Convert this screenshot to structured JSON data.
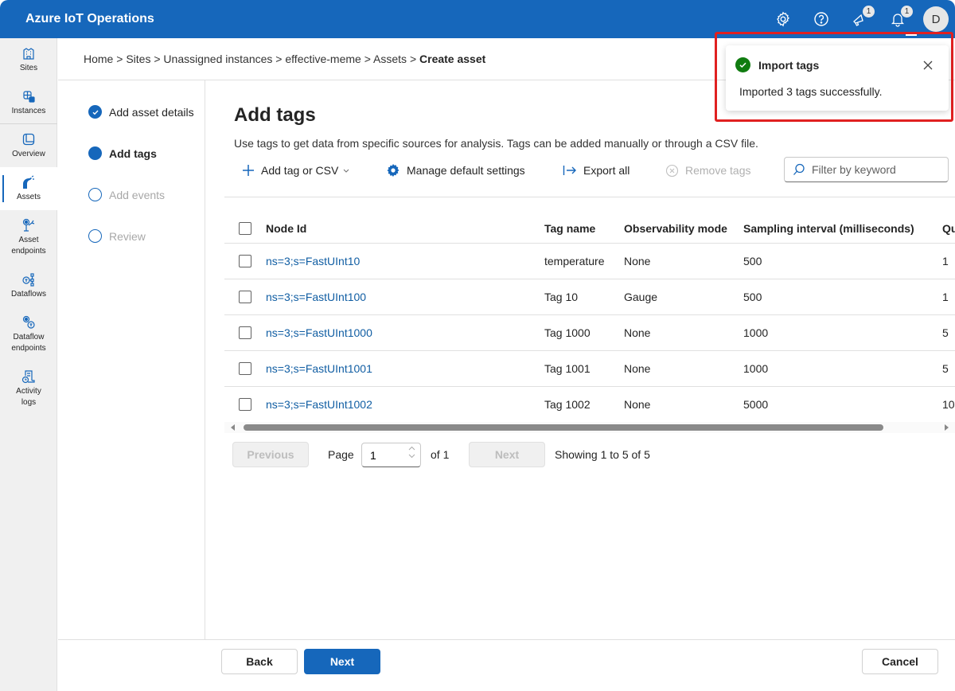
{
  "app": {
    "title": "Azure IoT Operations"
  },
  "topbar": {
    "settings_label": "Settings",
    "help_label": "Help",
    "whats_new_badge": "1",
    "notifications_badge": "1",
    "avatar_initial": "D"
  },
  "nav": {
    "items": [
      {
        "label": "Sites",
        "icon": "building-icon"
      },
      {
        "label": "Instances",
        "icon": "instances-icon"
      },
      {
        "label": "Overview",
        "icon": "overview-icon"
      },
      {
        "label": "Assets",
        "icon": "robot-arm-icon",
        "active": true
      },
      {
        "label_line1": "Asset",
        "label_line2": "endpoints",
        "icon": "asset-endpoint-icon"
      },
      {
        "label": "Dataflows",
        "icon": "dataflow-icon"
      },
      {
        "label_line1": "Dataflow",
        "label_line2": "endpoints",
        "icon": "dataflow-endpoint-icon"
      },
      {
        "label_line1": "Activity",
        "label_line2": "logs",
        "icon": "activity-log-icon"
      }
    ]
  },
  "breadcrumb": {
    "items": [
      "Home",
      "Sites",
      "Unassigned instances",
      "effective-meme",
      "Assets"
    ],
    "separator": ">",
    "current": "Create asset"
  },
  "steps": [
    {
      "label": "Add asset details",
      "state": "done"
    },
    {
      "label": "Add tags",
      "state": "current"
    },
    {
      "label": "Add events",
      "state": "todo"
    },
    {
      "label": "Review",
      "state": "todo"
    }
  ],
  "main": {
    "title": "Add tags",
    "description": "Use tags to get data from specific sources for analysis. Tags can be added manually or through a CSV file.",
    "toolbar": {
      "add_label": "Add tag or CSV",
      "manage_label": "Manage default settings",
      "export_label": "Export all",
      "remove_label": "Remove tags"
    },
    "search": {
      "placeholder": "Filter by keyword",
      "value": ""
    }
  },
  "table": {
    "columns": [
      "Node Id",
      "Tag name",
      "Observability mode",
      "Sampling interval (milliseconds)",
      "Qu"
    ],
    "rows": [
      {
        "node_id": "ns=3;s=FastUInt10",
        "tag_name": "temperature",
        "mode": "None",
        "sampling": "500",
        "queue": "1"
      },
      {
        "node_id": "ns=3;s=FastUInt100",
        "tag_name": "Tag 10",
        "mode": "Gauge",
        "sampling": "500",
        "queue": "1"
      },
      {
        "node_id": "ns=3;s=FastUInt1000",
        "tag_name": "Tag 1000",
        "mode": "None",
        "sampling": "1000",
        "queue": "5"
      },
      {
        "node_id": "ns=3;s=FastUInt1001",
        "tag_name": "Tag 1001",
        "mode": "None",
        "sampling": "1000",
        "queue": "5"
      },
      {
        "node_id": "ns=3;s=FastUInt1002",
        "tag_name": "Tag 1002",
        "mode": "None",
        "sampling": "5000",
        "queue": "10"
      }
    ]
  },
  "pagination": {
    "previous_label": "Previous",
    "page_label": "Page",
    "page_value": "1",
    "of_label": "of 1",
    "next_label": "Next",
    "showing": "Showing 1 to 5 of 5"
  },
  "footer": {
    "back_label": "Back",
    "next_label": "Next",
    "cancel_label": "Cancel"
  },
  "toast": {
    "title": "Import tags",
    "message": "Imported 3 tags successfully.",
    "status": "success"
  },
  "colors": {
    "brand": "#1667bb",
    "link": "#115ea3",
    "success": "#107c10",
    "highlight": "#e02020"
  }
}
